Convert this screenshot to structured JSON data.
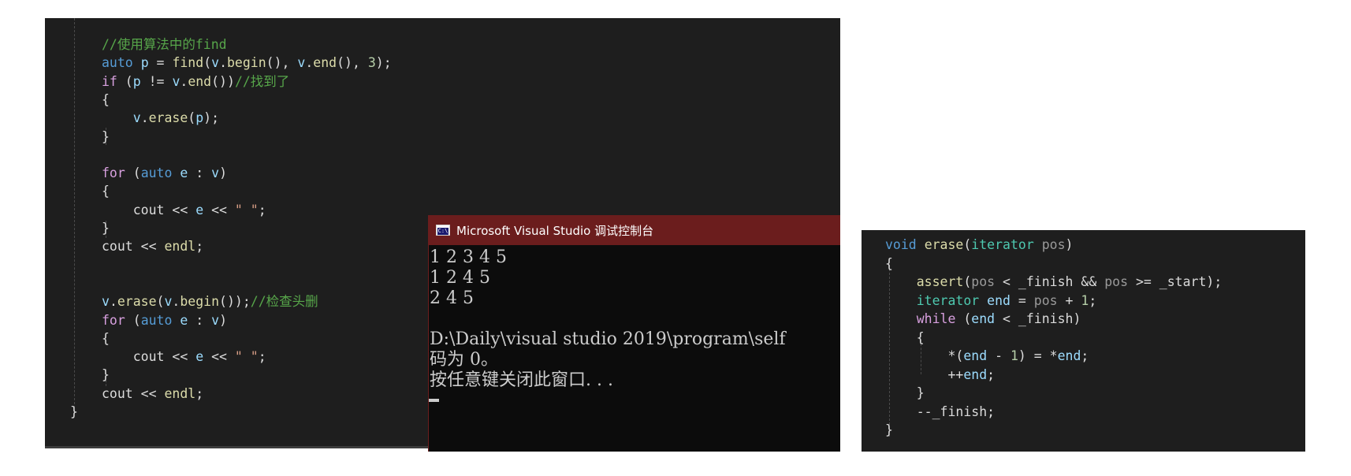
{
  "left_editor": {
    "lines": [
      [
        {
          "t": "//使用算法中的find",
          "c": "cmt"
        }
      ],
      [
        {
          "t": "auto",
          "c": "kw"
        },
        {
          "t": " ",
          "c": "plain"
        },
        {
          "t": "p",
          "c": "var"
        },
        {
          "t": " = ",
          "c": "plain"
        },
        {
          "t": "find",
          "c": "fn"
        },
        {
          "t": "(",
          "c": "plain"
        },
        {
          "t": "v",
          "c": "var"
        },
        {
          "t": ".",
          "c": "plain"
        },
        {
          "t": "begin",
          "c": "fn"
        },
        {
          "t": "(), ",
          "c": "plain"
        },
        {
          "t": "v",
          "c": "var"
        },
        {
          "t": ".",
          "c": "plain"
        },
        {
          "t": "end",
          "c": "fn"
        },
        {
          "t": "(), ",
          "c": "plain"
        },
        {
          "t": "3",
          "c": "num"
        },
        {
          "t": ");",
          "c": "plain"
        }
      ],
      [
        {
          "t": "if",
          "c": "ctl"
        },
        {
          "t": " (",
          "c": "plain"
        },
        {
          "t": "p",
          "c": "var"
        },
        {
          "t": " != ",
          "c": "plain"
        },
        {
          "t": "v",
          "c": "var"
        },
        {
          "t": ".",
          "c": "plain"
        },
        {
          "t": "end",
          "c": "fn"
        },
        {
          "t": "())",
          "c": "plain"
        },
        {
          "t": "//找到了",
          "c": "cmt"
        }
      ],
      [
        {
          "t": "{",
          "c": "plain"
        }
      ],
      [
        {
          "t": "    ",
          "c": "plain"
        },
        {
          "t": "v",
          "c": "var"
        },
        {
          "t": ".",
          "c": "plain"
        },
        {
          "t": "erase",
          "c": "fn"
        },
        {
          "t": "(",
          "c": "plain"
        },
        {
          "t": "p",
          "c": "var"
        },
        {
          "t": ");",
          "c": "plain"
        }
      ],
      [
        {
          "t": "}",
          "c": "plain"
        }
      ],
      [
        {
          "t": "",
          "c": "plain"
        }
      ],
      [
        {
          "t": "for",
          "c": "ctl"
        },
        {
          "t": " (",
          "c": "plain"
        },
        {
          "t": "auto",
          "c": "kw"
        },
        {
          "t": " ",
          "c": "plain"
        },
        {
          "t": "e",
          "c": "var"
        },
        {
          "t": " : ",
          "c": "plain"
        },
        {
          "t": "v",
          "c": "var"
        },
        {
          "t": ")",
          "c": "plain"
        }
      ],
      [
        {
          "t": "{",
          "c": "plain"
        }
      ],
      [
        {
          "t": "    cout << ",
          "c": "plain"
        },
        {
          "t": "e",
          "c": "var"
        },
        {
          "t": " << ",
          "c": "plain"
        },
        {
          "t": "\" \"",
          "c": "str"
        },
        {
          "t": ";",
          "c": "plain"
        }
      ],
      [
        {
          "t": "}",
          "c": "plain"
        }
      ],
      [
        {
          "t": "cout << ",
          "c": "plain"
        },
        {
          "t": "endl",
          "c": "fn"
        },
        {
          "t": ";",
          "c": "plain"
        }
      ],
      [
        {
          "t": "",
          "c": "plain"
        }
      ],
      [
        {
          "t": "",
          "c": "plain"
        }
      ],
      [
        {
          "t": "v",
          "c": "var"
        },
        {
          "t": ".",
          "c": "plain"
        },
        {
          "t": "erase",
          "c": "fn"
        },
        {
          "t": "(",
          "c": "plain"
        },
        {
          "t": "v",
          "c": "var"
        },
        {
          "t": ".",
          "c": "plain"
        },
        {
          "t": "begin",
          "c": "fn"
        },
        {
          "t": "());",
          "c": "plain"
        },
        {
          "t": "//检查头删",
          "c": "cmt"
        }
      ],
      [
        {
          "t": "for",
          "c": "ctl"
        },
        {
          "t": " (",
          "c": "plain"
        },
        {
          "t": "auto",
          "c": "kw"
        },
        {
          "t": " ",
          "c": "plain"
        },
        {
          "t": "e",
          "c": "var"
        },
        {
          "t": " : ",
          "c": "plain"
        },
        {
          "t": "v",
          "c": "var"
        },
        {
          "t": ")",
          "c": "plain"
        }
      ],
      [
        {
          "t": "{",
          "c": "plain"
        }
      ],
      [
        {
          "t": "    cout << ",
          "c": "plain"
        },
        {
          "t": "e",
          "c": "var"
        },
        {
          "t": " << ",
          "c": "plain"
        },
        {
          "t": "\" \"",
          "c": "str"
        },
        {
          "t": ";",
          "c": "plain"
        }
      ],
      [
        {
          "t": "}",
          "c": "plain"
        }
      ],
      [
        {
          "t": "cout << ",
          "c": "plain"
        },
        {
          "t": "endl",
          "c": "fn"
        },
        {
          "t": ";",
          "c": "plain"
        }
      ],
      [
        {
          "t": "}",
          "c": "plain"
        }
      ]
    ]
  },
  "console": {
    "title": "Microsoft Visual Studio 调试控制台",
    "icon": "console-app-icon",
    "icon_text": "C:\\",
    "lines": [
      "1 2 3 4 5",
      "1 2 4 5",
      "2 4 5",
      "",
      "D:\\Daily\\visual studio 2019\\program\\self",
      "码为 0。",
      "按任意键关闭此窗口. . ."
    ]
  },
  "right_editor": {
    "lines": [
      [
        {
          "t": "void",
          "c": "kw"
        },
        {
          "t": " ",
          "c": "plain"
        },
        {
          "t": "erase",
          "c": "fn"
        },
        {
          "t": "(",
          "c": "plain"
        },
        {
          "t": "iterator",
          "c": "type"
        },
        {
          "t": " ",
          "c": "plain"
        },
        {
          "t": "pos",
          "c": "param"
        },
        {
          "t": ")",
          "c": "plain"
        }
      ],
      [
        {
          "t": "{",
          "c": "plain"
        }
      ],
      [
        {
          "t": "    ",
          "c": "plain"
        },
        {
          "t": "assert",
          "c": "fn"
        },
        {
          "t": "(",
          "c": "plain"
        },
        {
          "t": "pos",
          "c": "param"
        },
        {
          "t": " < ",
          "c": "plain"
        },
        {
          "t": "_finish",
          "c": "field"
        },
        {
          "t": " && ",
          "c": "plain"
        },
        {
          "t": "pos",
          "c": "param"
        },
        {
          "t": " >= ",
          "c": "plain"
        },
        {
          "t": "_start",
          "c": "field"
        },
        {
          "t": ");",
          "c": "plain"
        }
      ],
      [
        {
          "t": "    ",
          "c": "plain"
        },
        {
          "t": "iterator",
          "c": "type"
        },
        {
          "t": " ",
          "c": "plain"
        },
        {
          "t": "end",
          "c": "var"
        },
        {
          "t": " = ",
          "c": "plain"
        },
        {
          "t": "pos",
          "c": "param"
        },
        {
          "t": " + ",
          "c": "plain"
        },
        {
          "t": "1",
          "c": "num"
        },
        {
          "t": ";",
          "c": "plain"
        }
      ],
      [
        {
          "t": "    ",
          "c": "plain"
        },
        {
          "t": "while",
          "c": "ctl"
        },
        {
          "t": " (",
          "c": "plain"
        },
        {
          "t": "end",
          "c": "var"
        },
        {
          "t": " < ",
          "c": "plain"
        },
        {
          "t": "_finish",
          "c": "field"
        },
        {
          "t": ")",
          "c": "plain"
        }
      ],
      [
        {
          "t": "    {",
          "c": "plain"
        }
      ],
      [
        {
          "t": "        *(",
          "c": "plain"
        },
        {
          "t": "end",
          "c": "var"
        },
        {
          "t": " - ",
          "c": "plain"
        },
        {
          "t": "1",
          "c": "num"
        },
        {
          "t": ") = *",
          "c": "plain"
        },
        {
          "t": "end",
          "c": "var"
        },
        {
          "t": ";",
          "c": "plain"
        }
      ],
      [
        {
          "t": "        ++",
          "c": "plain"
        },
        {
          "t": "end",
          "c": "var"
        },
        {
          "t": ";",
          "c": "plain"
        }
      ],
      [
        {
          "t": "    }",
          "c": "plain"
        }
      ],
      [
        {
          "t": "    --",
          "c": "plain"
        },
        {
          "t": "_finish",
          "c": "field"
        },
        {
          "t": ";",
          "c": "plain"
        }
      ],
      [
        {
          "t": "}",
          "c": "plain"
        }
      ]
    ]
  }
}
